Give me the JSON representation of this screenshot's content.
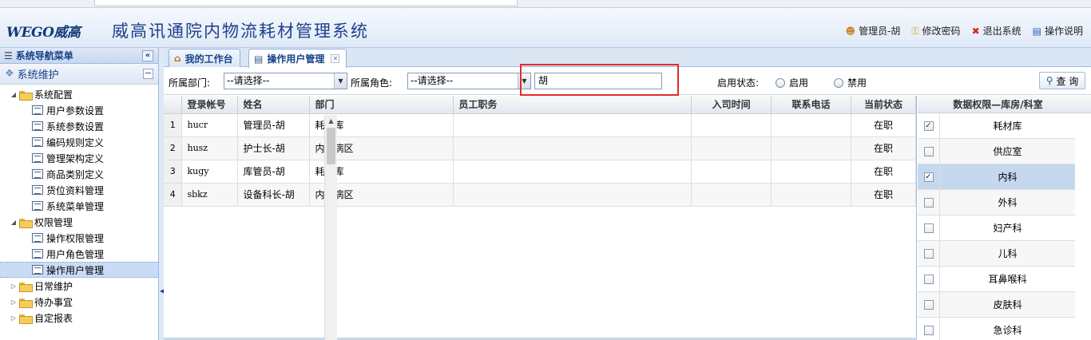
{
  "header": {
    "logo": "WEGO威高",
    "title": "威高讯通院内物流耗材管理系统",
    "links": [
      {
        "label": "管理员-胡",
        "icon": "user-icon"
      },
      {
        "label": "修改密码",
        "icon": "key-icon"
      },
      {
        "label": "退出系统",
        "icon": "close-icon"
      },
      {
        "label": "操作说明",
        "icon": "book-icon"
      }
    ]
  },
  "sidebar": {
    "nav_title": "系统导航菜单",
    "section_title": "系统维护",
    "groups": [
      {
        "label": "系统配置",
        "items": [
          "用户参数设置",
          "系统参数设置",
          "编码规则定义",
          "管理架构定义",
          "商品类别定义",
          "货位资料管理",
          "系统菜单管理"
        ]
      },
      {
        "label": "权限管理",
        "items": [
          "操作权限管理",
          "用户角色管理",
          "操作用户管理"
        ]
      }
    ],
    "collapsed_groups": [
      "日常维护",
      "待办事宜",
      "自定报表"
    ],
    "selected_item": "操作用户管理"
  },
  "tabs": [
    {
      "label": "我的工作台",
      "icon": "home-icon"
    },
    {
      "label": "操作用户管理",
      "icon": "list-icon"
    }
  ],
  "filter": {
    "dept_label": "所属部门:",
    "dept_value": "--请选择--",
    "role_label": "所属角色:",
    "role_value": "--请选择--",
    "name_value": "胡",
    "status_label": "启用状态:",
    "enable_label": "启用",
    "disable_label": "禁用",
    "search_label": "查 询"
  },
  "users_table": {
    "columns": [
      "",
      "登录帐号",
      "姓名",
      "部门",
      "员工职务",
      "入司时间",
      "联系电话",
      "当前状态"
    ],
    "rows": [
      [
        "1",
        "hucr",
        "管理员-胡",
        "耗材库",
        "",
        "",
        "",
        "在职"
      ],
      [
        "2",
        "husz",
        "护士长-胡",
        "内二病区",
        "",
        "",
        "",
        "在职"
      ],
      [
        "3",
        "kugy",
        "库管员-胡",
        "耗材库",
        "",
        "",
        "",
        "在职"
      ],
      [
        "4",
        "sbkz",
        "设备科长-胡",
        "内二病区",
        "",
        "",
        "",
        "在职"
      ]
    ]
  },
  "permissions": {
    "title": "数据权限—库房/科室",
    "items": [
      {
        "name": "耗材库",
        "checked": true
      },
      {
        "name": "供应室",
        "checked": false
      },
      {
        "name": "内科",
        "checked": true
      },
      {
        "name": "外科",
        "checked": false
      },
      {
        "name": "妇产科",
        "checked": false
      },
      {
        "name": "儿科",
        "checked": false
      },
      {
        "name": "耳鼻喉科",
        "checked": false
      },
      {
        "name": "皮肤科",
        "checked": false
      },
      {
        "name": "急诊科",
        "checked": false
      }
    ]
  }
}
